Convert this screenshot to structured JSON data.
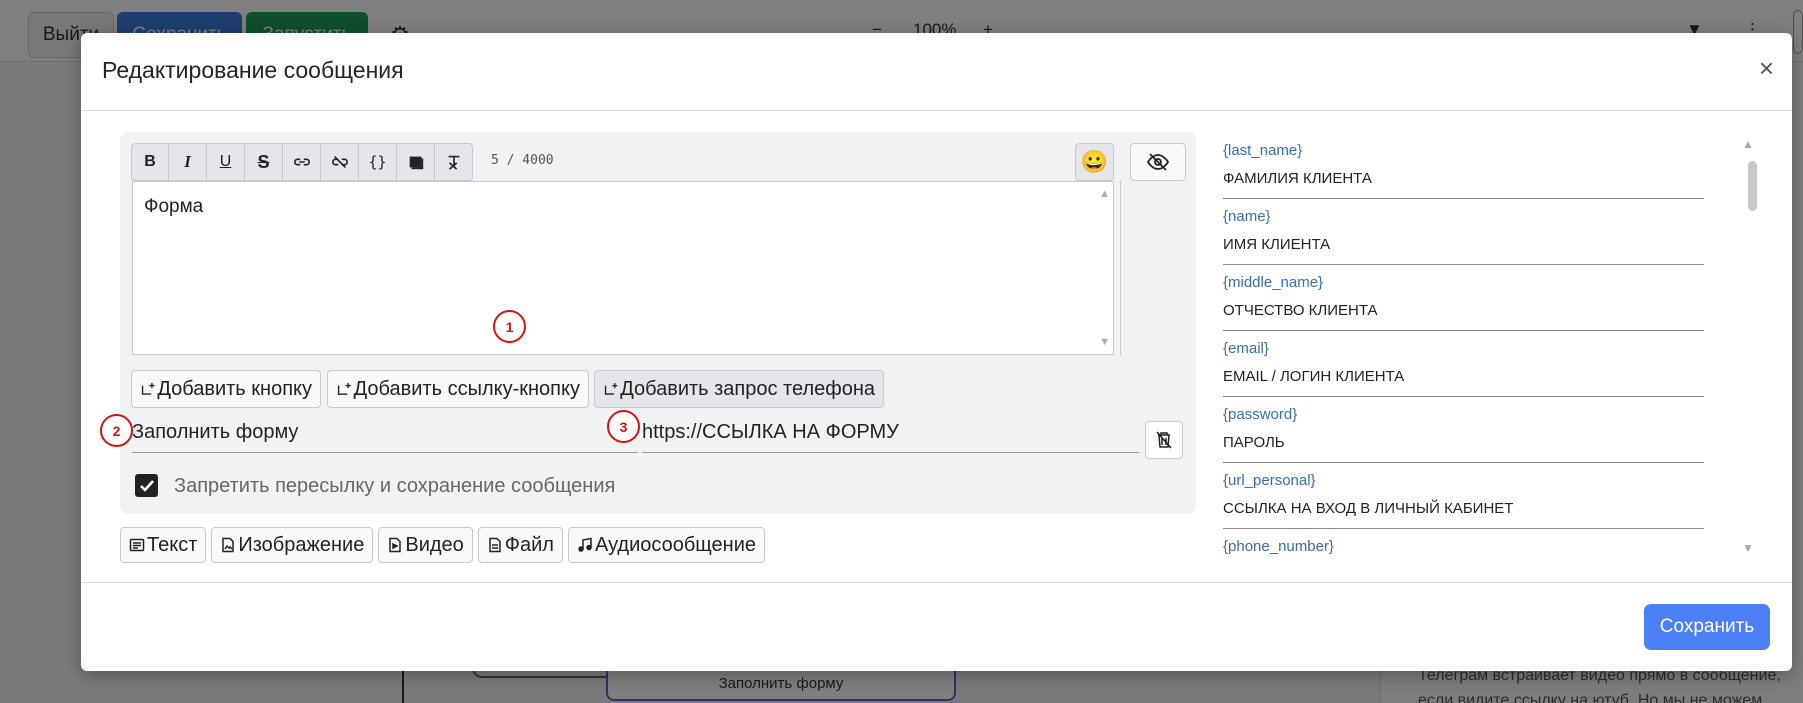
{
  "background": {
    "exit_label": "Выйти",
    "save_label": "Сохранить",
    "run_label": "Запустить",
    "zoom_minus": "−",
    "zoom_level": "100%",
    "zoom_plus": "+",
    "node_label": "Заполнить форму",
    "right_text": "Телеграм встраивает видео прямо в сообщение, если видите ссылку на ютуб. Но мы не можем отслеживать клики по за"
  },
  "modal": {
    "title": "Редактирование сообщения",
    "close_label": "×",
    "save_label": "Сохранить"
  },
  "editor": {
    "toolbar": [
      "B",
      "I",
      "U",
      "S",
      "link",
      "unlink",
      "{}",
      "block",
      "clear"
    ],
    "counter": "5 / 4000",
    "text": "Форма",
    "emoji": "😀"
  },
  "actions": {
    "add_button": "Добавить кнопку",
    "add_link_button": "Добавить ссылку-кнопку",
    "add_phone_request": "Добавить запрос телефона"
  },
  "button_fields": {
    "button_text": "Заполнить форму",
    "button_url": "https://ССЫЛКА НА ФОРМУ"
  },
  "forbid_forward": {
    "label": "Запретить пересылку и сохранение сообщения",
    "checked": true
  },
  "badges": [
    "1",
    "2",
    "3"
  ],
  "content_types": {
    "text": "Текст",
    "image": "Изображение",
    "video": "Видео",
    "file": "Файл",
    "audio": "Аудиосообщение"
  },
  "variables": [
    {
      "key": "{last_name}",
      "desc": "ФАМИЛИЯ КЛИЕНТА"
    },
    {
      "key": "{name}",
      "desc": "ИМЯ КЛИЕНТА"
    },
    {
      "key": "{middle_name}",
      "desc": "ОТЧЕСТВО КЛИЕНТА"
    },
    {
      "key": "{email}",
      "desc": "EMAIL / ЛОГИН КЛИЕНТА"
    },
    {
      "key": "{password}",
      "desc": "ПАРОЛЬ"
    },
    {
      "key": "{url_personal}",
      "desc": "ССЫЛКА НА ВХОД В ЛИЧНЫЙ КАБИНЕТ"
    },
    {
      "key": "{phone_number}",
      "desc": ""
    }
  ],
  "colors": {
    "primary": "#4a7ff6",
    "badge": "#d41313",
    "variable_key": "#3a6ea5"
  }
}
